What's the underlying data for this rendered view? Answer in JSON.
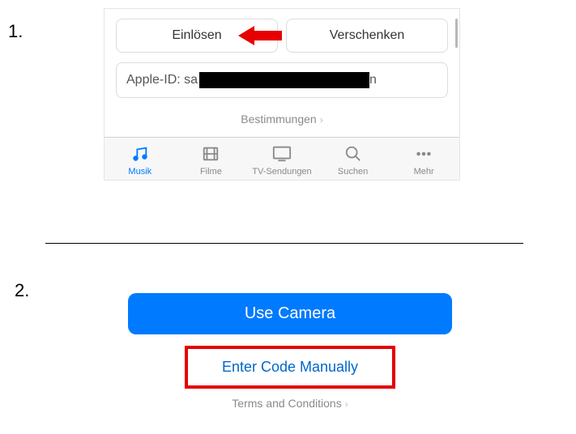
{
  "steps": {
    "one": "1.",
    "two": "2."
  },
  "panel1": {
    "redeem": "Einlösen",
    "gift": "Verschenken",
    "appleid_prefix": "Apple-ID: sa",
    "appleid_suffix": "n",
    "terms": "Bestimmungen",
    "tabs": {
      "music": "Musik",
      "films": "Filme",
      "tv": "TV-Sendungen",
      "search": "Suchen",
      "more": "Mehr"
    }
  },
  "panel2": {
    "use_camera": "Use Camera",
    "enter_manually": "Enter Code Manually",
    "terms": "Terms and Conditions"
  }
}
